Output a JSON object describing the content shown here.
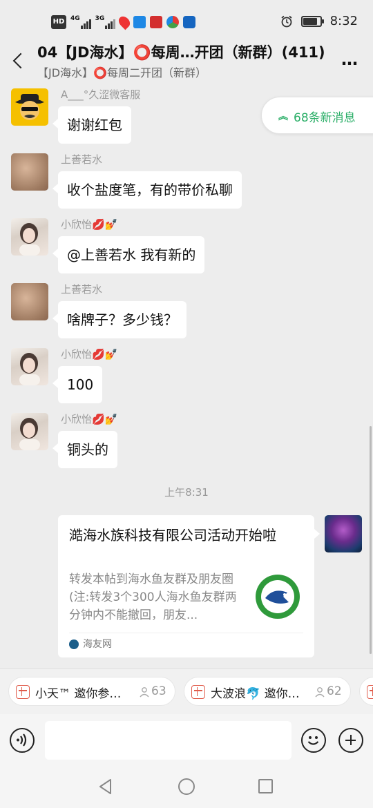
{
  "status_bar": {
    "time": "8:32",
    "hd_label": "HD",
    "signal1": "4G",
    "signal2": "3G",
    "battery_level": 0.85,
    "icons": [
      "hd-icon",
      "signal-4g-icon",
      "signal-3g-icon",
      "location-icon",
      "notify-app-icon",
      "news-app-icon",
      "browser-app-icon",
      "paw-app-icon",
      "alarm-icon",
      "battery-icon"
    ]
  },
  "header": {
    "title": "04【JD海水】⭕每周…开团（新群）(411)",
    "subtitle": "【JD海水】⭕每周二开团（新群）",
    "more": "…"
  },
  "new_messages": "68条新消息",
  "messages": [
    {
      "sender": "A___°久涩微客服",
      "text": "谢谢红包",
      "avatar": "cowboy-emoji-avatar"
    },
    {
      "sender": "上善若水",
      "text": "收个盐度笔，有的带价私聊",
      "avatar": "photo-avatar-brown"
    },
    {
      "sender": "小欣怡💋💅",
      "text": "@上善若水  我有新的",
      "avatar": "photo-avatar-girl"
    },
    {
      "sender": "上善若水",
      "text": "啥牌子？多少钱？",
      "avatar": "photo-avatar-brown"
    },
    {
      "sender": "小欣怡💋💅",
      "text": "100",
      "avatar": "photo-avatar-girl"
    },
    {
      "sender": "小欣怡💋💅",
      "text": "铜头的",
      "avatar": "photo-avatar-girl"
    }
  ],
  "timestamp": "上午8:31",
  "link_card": {
    "title": "澔海水族科技有限公司活动开始啦",
    "description": "转发本帖到海水鱼友群及朋友圈(注:转发3个300人海水鱼友群两分钟内不能撤回，朋友...",
    "source": "海友网",
    "colors": {
      "logo_green": "#2f9a3b",
      "logo_blue": "#1f4f9a"
    }
  },
  "red_packets": [
    {
      "text": "小天™ 邀你参…",
      "count": "63"
    },
    {
      "text": "大波浪🐬 邀你…",
      "count": "62"
    }
  ],
  "input": {
    "placeholder": ""
  },
  "colors": {
    "accent_green": "#2aae67",
    "background": "#ededed",
    "red_packet": "#e05c4b"
  }
}
